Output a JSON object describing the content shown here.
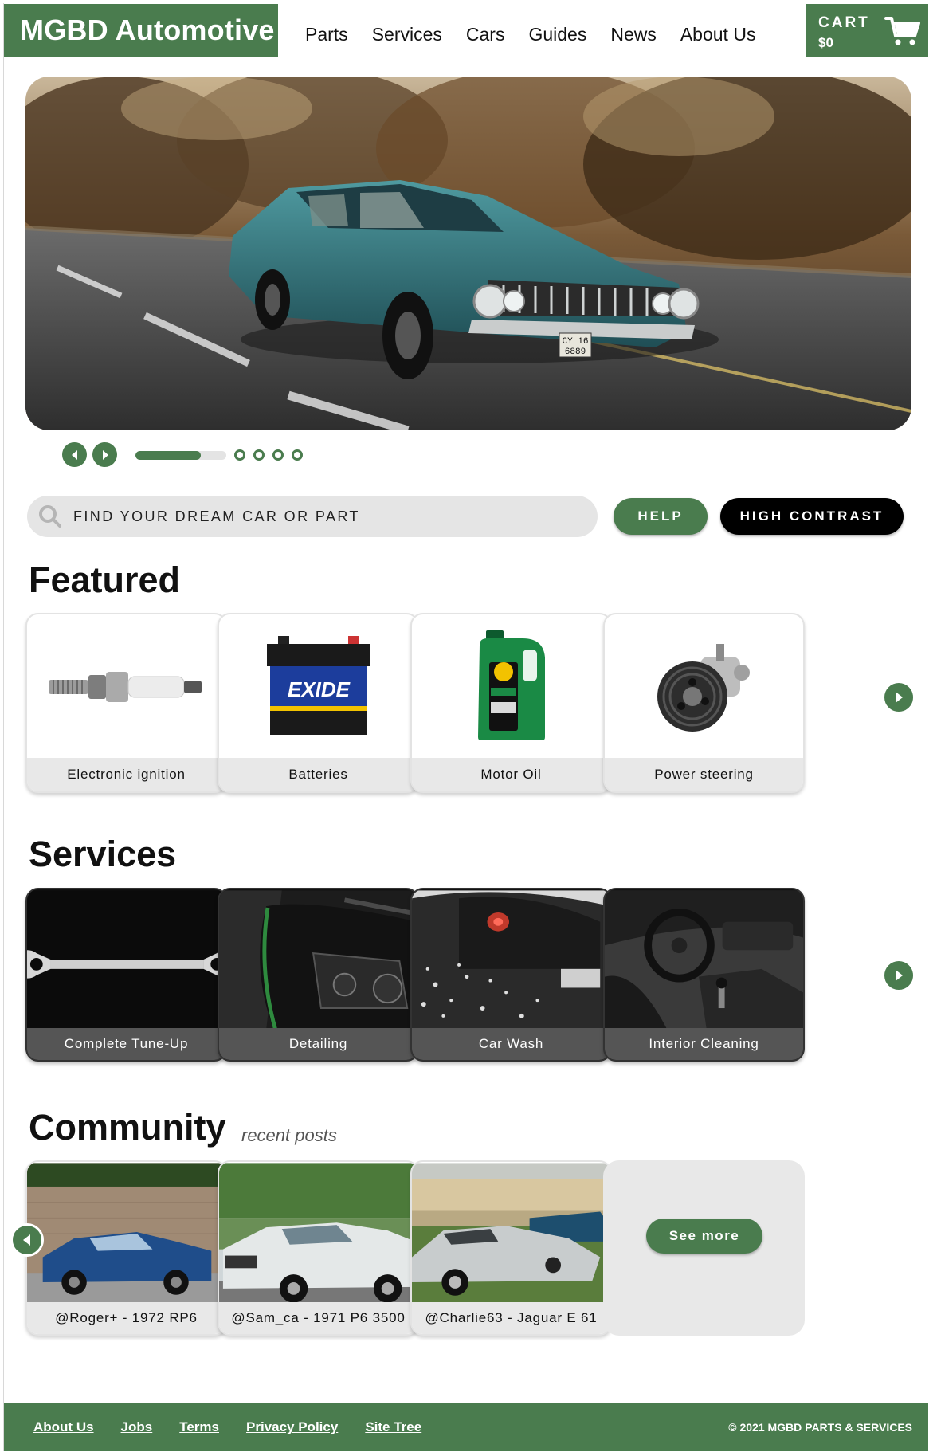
{
  "header": {
    "logo": "MGBD Automotive",
    "nav": [
      "Parts",
      "Services",
      "Cars",
      "Guides",
      "News",
      "About Us"
    ],
    "cart_label": "CART",
    "cart_total": "$0"
  },
  "hero": {
    "plate_line1": "CY 16",
    "plate_line2": "6889",
    "progress": 0.72,
    "dot_count": 4
  },
  "search": {
    "placeholder": "FIND YOUR DREAM CAR OR PART",
    "help_label": "HELP",
    "high_contrast_label": "HIGH CONTRAST"
  },
  "featured": {
    "title": "Featured",
    "items": [
      {
        "label": "Electronic ignition",
        "icon": "spark-plug-icon"
      },
      {
        "label": "Batteries",
        "icon": "battery-icon",
        "brand": "EXIDE"
      },
      {
        "label": "Motor Oil",
        "icon": "oil-jug-icon"
      },
      {
        "label": "Power steering",
        "icon": "power-steering-pump-icon"
      }
    ]
  },
  "services": {
    "title": "Services",
    "items": [
      {
        "label": "Complete Tune-Up"
      },
      {
        "label": "Detailing"
      },
      {
        "label": "Car Wash"
      },
      {
        "label": "Interior Cleaning"
      }
    ]
  },
  "community": {
    "title": "Community",
    "subtitle": "recent posts",
    "posts": [
      {
        "label": "@Roger+ - 1972 RP6"
      },
      {
        "label": "@Sam_ca - 1971 P6 3500"
      },
      {
        "label": "@Charlie63 - Jaguar E 61"
      }
    ],
    "see_more": "See more"
  },
  "footer": {
    "links": [
      "About Us",
      "Jobs",
      "Terms",
      "Privacy Policy",
      "Site Tree"
    ],
    "copyright": "© 2021 MGBD PARTS & SERVICES"
  },
  "colors": {
    "brand_green": "#4a7c4e",
    "black": "#000000",
    "light_gray": "#e8e8e8"
  }
}
